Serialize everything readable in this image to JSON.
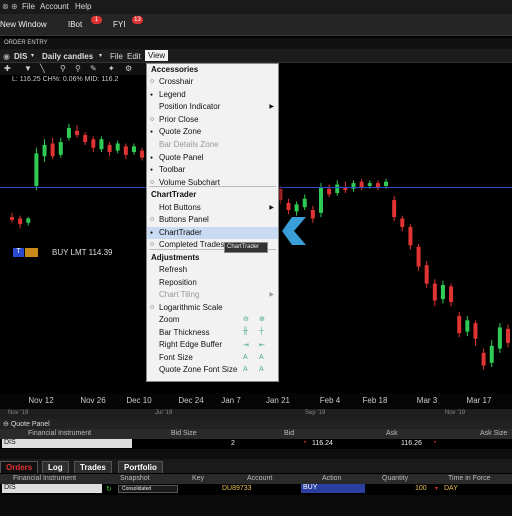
{
  "menubar": {
    "items": [
      "File",
      "Account",
      "Help"
    ]
  },
  "toolbar": {
    "new_window": "New Window",
    "ibot": "IBot",
    "ibot_badge": "1",
    "fyi": "FYI",
    "fyi_badge": "13"
  },
  "order_entry": "ORDER ENTRY",
  "chart_header": {
    "symbol": "DIS",
    "timeframe": "Daily candles",
    "menus": [
      "File",
      "Edit",
      "View"
    ]
  },
  "quote_line": "L: 116.25 CH%: 0.06%  MID: 116.2",
  "order_line": {
    "tag": "T",
    "label": "BUY LMT 114.39"
  },
  "chart_data": {
    "type": "candlestick",
    "x_tick_labels": [
      "Nov 12",
      "Nov 26",
      "Dec 10",
      "Dec 24",
      "Jan 7",
      "Jan 21",
      "Feb 4",
      "Feb 18",
      "Mar 3",
      "Mar 17"
    ],
    "candles": [
      {
        "o": 112.3,
        "c": 112.1,
        "h": 112.6,
        "l": 111.9,
        "up": false
      },
      {
        "o": 112.2,
        "c": 111.8,
        "h": 112.4,
        "l": 111.5,
        "up": false
      },
      {
        "o": 111.9,
        "c": 112.2,
        "h": 112.3,
        "l": 111.7,
        "up": true
      },
      {
        "o": 114.5,
        "c": 116.8,
        "h": 117.2,
        "l": 114.2,
        "up": true
      },
      {
        "o": 116.6,
        "c": 117.4,
        "h": 117.8,
        "l": 116.2,
        "up": true
      },
      {
        "o": 117.5,
        "c": 116.6,
        "h": 117.9,
        "l": 116.4,
        "up": false
      },
      {
        "o": 116.7,
        "c": 117.6,
        "h": 117.9,
        "l": 116.5,
        "up": true
      },
      {
        "o": 117.9,
        "c": 118.6,
        "h": 118.9,
        "l": 117.7,
        "up": true
      },
      {
        "o": 118.4,
        "c": 118.1,
        "h": 118.8,
        "l": 117.9,
        "up": false
      },
      {
        "o": 118.1,
        "c": 117.6,
        "h": 118.3,
        "l": 117.4,
        "up": false
      },
      {
        "o": 117.8,
        "c": 117.2,
        "h": 118.0,
        "l": 116.9,
        "up": false
      },
      {
        "o": 117.1,
        "c": 117.8,
        "h": 118.0,
        "l": 116.9,
        "up": true
      },
      {
        "o": 117.4,
        "c": 116.9,
        "h": 117.6,
        "l": 116.6,
        "up": false
      },
      {
        "o": 117.0,
        "c": 117.5,
        "h": 117.7,
        "l": 116.8,
        "up": true
      },
      {
        "o": 117.3,
        "c": 116.7,
        "h": 117.5,
        "l": 116.4,
        "up": false
      },
      {
        "o": 116.9,
        "c": 117.3,
        "h": 117.5,
        "l": 116.7,
        "up": true
      },
      {
        "o": 117.0,
        "c": 116.5,
        "h": 117.2,
        "l": 116.3,
        "up": false
      },
      {
        "o": 116.5,
        "c": 116.8,
        "h": 117.0,
        "l": 116.3,
        "up": true
      },
      {
        "o": 116.1,
        "c": 115.4,
        "h": 116.4,
        "l": 115.0,
        "up": false
      },
      {
        "o": 115.3,
        "c": 116.0,
        "h": 116.3,
        "l": 115.0,
        "up": true
      },
      {
        "o": 116.0,
        "c": 116.5,
        "h": 116.8,
        "l": 115.8,
        "up": true
      },
      {
        "o": 116.5,
        "c": 116.3,
        "h": 116.9,
        "l": 116.0,
        "up": false
      },
      {
        "o": 116.4,
        "c": 116.8,
        "h": 117.0,
        "l": 116.2,
        "up": true
      },
      {
        "o": 116.9,
        "c": 116.4,
        "h": 117.2,
        "l": 116.2,
        "up": false
      },
      {
        "o": 116.5,
        "c": 116.9,
        "h": 117.1,
        "l": 116.3,
        "up": true
      },
      {
        "o": 115.8,
        "c": 116.5,
        "h": 116.8,
        "l": 115.5,
        "up": true
      },
      {
        "o": 116.6,
        "c": 116.4,
        "h": 116.9,
        "l": 116.2,
        "up": false
      },
      {
        "o": 116.7,
        "c": 115.9,
        "h": 116.9,
        "l": 115.6,
        "up": false
      },
      {
        "o": 115.7,
        "c": 114.9,
        "h": 115.9,
        "l": 114.6,
        "up": false
      },
      {
        "o": 115.0,
        "c": 114.4,
        "h": 115.2,
        "l": 114.2,
        "up": false
      },
      {
        "o": 114.4,
        "c": 114.8,
        "h": 115.0,
        "l": 114.2,
        "up": true
      },
      {
        "o": 114.7,
        "c": 114.2,
        "h": 115.0,
        "l": 114.0,
        "up": false
      },
      {
        "o": 113.9,
        "c": 114.3,
        "h": 114.6,
        "l": 113.7,
        "up": true
      },
      {
        "o": 114.3,
        "c": 113.5,
        "h": 114.5,
        "l": 113.2,
        "up": false
      },
      {
        "o": 113.3,
        "c": 112.8,
        "h": 113.6,
        "l": 112.5,
        "up": false
      },
      {
        "o": 112.7,
        "c": 113.2,
        "h": 113.4,
        "l": 112.4,
        "up": true
      },
      {
        "o": 113.0,
        "c": 113.6,
        "h": 113.9,
        "l": 112.8,
        "up": true
      },
      {
        "o": 112.8,
        "c": 112.2,
        "h": 113.1,
        "l": 111.9,
        "up": false
      },
      {
        "o": 112.6,
        "c": 114.4,
        "h": 114.7,
        "l": 112.3,
        "up": true
      },
      {
        "o": 114.3,
        "c": 113.9,
        "h": 114.6,
        "l": 113.7,
        "up": false
      },
      {
        "o": 114.0,
        "c": 114.6,
        "h": 114.9,
        "l": 113.8,
        "up": true
      },
      {
        "o": 114.4,
        "c": 114.2,
        "h": 114.8,
        "l": 114.0,
        "up": false
      },
      {
        "o": 114.3,
        "c": 114.7,
        "h": 114.9,
        "l": 114.1,
        "up": true
      },
      {
        "o": 114.8,
        "c": 114.4,
        "h": 115.0,
        "l": 114.2,
        "up": false
      },
      {
        "o": 114.5,
        "c": 114.7,
        "h": 114.9,
        "l": 114.3,
        "up": true
      },
      {
        "o": 114.7,
        "c": 114.4,
        "h": 114.9,
        "l": 114.2,
        "up": false
      },
      {
        "o": 114.5,
        "c": 114.8,
        "h": 115.0,
        "l": 114.3,
        "up": true
      },
      {
        "o": 113.5,
        "c": 112.3,
        "h": 113.8,
        "l": 112.0,
        "up": false
      },
      {
        "o": 112.2,
        "c": 111.6,
        "h": 112.4,
        "l": 111.3,
        "up": false
      },
      {
        "o": 111.6,
        "c": 110.3,
        "h": 111.8,
        "l": 110.0,
        "up": false
      },
      {
        "o": 110.2,
        "c": 108.8,
        "h": 110.4,
        "l": 108.5,
        "up": false
      },
      {
        "o": 108.9,
        "c": 107.6,
        "h": 109.2,
        "l": 107.3,
        "up": false
      },
      {
        "o": 107.6,
        "c": 106.4,
        "h": 107.9,
        "l": 106.0,
        "up": false
      },
      {
        "o": 106.5,
        "c": 107.5,
        "h": 107.8,
        "l": 106.2,
        "up": true
      },
      {
        "o": 107.4,
        "c": 106.3,
        "h": 107.6,
        "l": 106.0,
        "up": false
      },
      {
        "o": 105.3,
        "c": 104.1,
        "h": 105.6,
        "l": 103.8,
        "up": false
      },
      {
        "o": 104.2,
        "c": 105.0,
        "h": 105.3,
        "l": 103.9,
        "up": true
      },
      {
        "o": 104.8,
        "c": 103.7,
        "h": 105.0,
        "l": 103.2,
        "up": false
      },
      {
        "o": 102.7,
        "c": 101.8,
        "h": 103.0,
        "l": 101.5,
        "up": false
      },
      {
        "o": 102.0,
        "c": 103.2,
        "h": 103.6,
        "l": 101.7,
        "up": true
      },
      {
        "o": 103.0,
        "c": 104.5,
        "h": 104.8,
        "l": 102.7,
        "up": true
      },
      {
        "o": 104.4,
        "c": 103.4,
        "h": 104.7,
        "l": 103.1,
        "up": false
      }
    ],
    "order_line_value": 114.39,
    "ylim": [
      100.5,
      121.0
    ]
  },
  "scroller_labels": [
    "Nov '19",
    "Jul '19",
    "Sep '19",
    "Nov '19"
  ],
  "dropdown": {
    "sections": {
      "accessories": "Accessories",
      "charttrader": "ChartTrader",
      "adjustments": "Adjustments"
    },
    "items": [
      {
        "label": "Crosshair",
        "mark": "o",
        "submenu": false,
        "disabled": false
      },
      {
        "label": "Legend",
        "mark": "•",
        "submenu": false,
        "disabled": false
      },
      {
        "label": "Position Indicator",
        "mark": "",
        "submenu": true,
        "disabled": false
      },
      {
        "label": "Prior Close",
        "mark": "o",
        "submenu": false,
        "disabled": false
      },
      {
        "label": "Quote Zone",
        "mark": "•",
        "submenu": false,
        "disabled": false
      },
      {
        "label": "Bar Details Zone",
        "mark": "",
        "submenu": false,
        "disabled": true
      },
      {
        "label": "Quote Panel",
        "mark": "•",
        "submenu": false,
        "disabled": false
      },
      {
        "label": "Toolbar",
        "mark": "•",
        "submenu": false,
        "disabled": false
      },
      {
        "label": "Volume Subchart",
        "mark": "o",
        "submenu": false,
        "disabled": false
      },
      {
        "label": "Hot Buttons",
        "mark": "",
        "submenu": true,
        "disabled": false
      },
      {
        "label": "Buttons Panel",
        "mark": "o",
        "submenu": false,
        "disabled": false
      },
      {
        "label": "ChartTrader",
        "mark": "•",
        "submenu": false,
        "disabled": false
      },
      {
        "label": "Completed Trades",
        "mark": "o",
        "submenu": false,
        "disabled": false
      },
      {
        "label": "Refresh",
        "mark": "",
        "submenu": false,
        "disabled": false
      },
      {
        "label": "Reposition",
        "mark": "",
        "submenu": false,
        "disabled": false
      },
      {
        "label": "Chart Tiling",
        "mark": "",
        "submenu": true,
        "disabled": true
      },
      {
        "label": "Logarithmic Scale",
        "mark": "o",
        "submenu": false,
        "disabled": false
      },
      {
        "label": "Zoom",
        "mark": "",
        "submenu": false,
        "disabled": false
      },
      {
        "label": "Bar Thickness",
        "mark": "",
        "submenu": false,
        "disabled": false
      },
      {
        "label": "Right Edge Buffer",
        "mark": "",
        "submenu": false,
        "disabled": false
      },
      {
        "label": "Font Size",
        "mark": "",
        "submenu": false,
        "disabled": false
      },
      {
        "label": "Quote Zone Font Size",
        "mark": "",
        "submenu": false,
        "disabled": false
      }
    ],
    "tooltip": "ChartTrader"
  },
  "quote_panel": {
    "title": "Quote Panel",
    "headers": [
      "Financial Instrument",
      "Bid Size",
      "Bid",
      "Ask",
      "Ask Size"
    ],
    "row": {
      "symbol": "DIS",
      "bid_size": "2",
      "bid": "116.24",
      "ask": "116.26"
    }
  },
  "orders": {
    "tabs": [
      "Orders",
      "Log",
      "Trades",
      "Portfolio"
    ],
    "headers": [
      "Financial Instrument",
      "Snapshot",
      "Key",
      "Account",
      "Action",
      "Quantity",
      "Time in Force"
    ],
    "row": {
      "symbol": "DIS",
      "snapshot": "Consolidated",
      "account": "DU89733",
      "action": "BUY",
      "quantity": "100",
      "tif": "DAY"
    }
  },
  "colors": {
    "up": "#2fcc55",
    "down": "#e03333",
    "menu_highlight": "#c9daf2",
    "arrow": "#3a9ed8",
    "action_bg": "#2a3fa0"
  }
}
